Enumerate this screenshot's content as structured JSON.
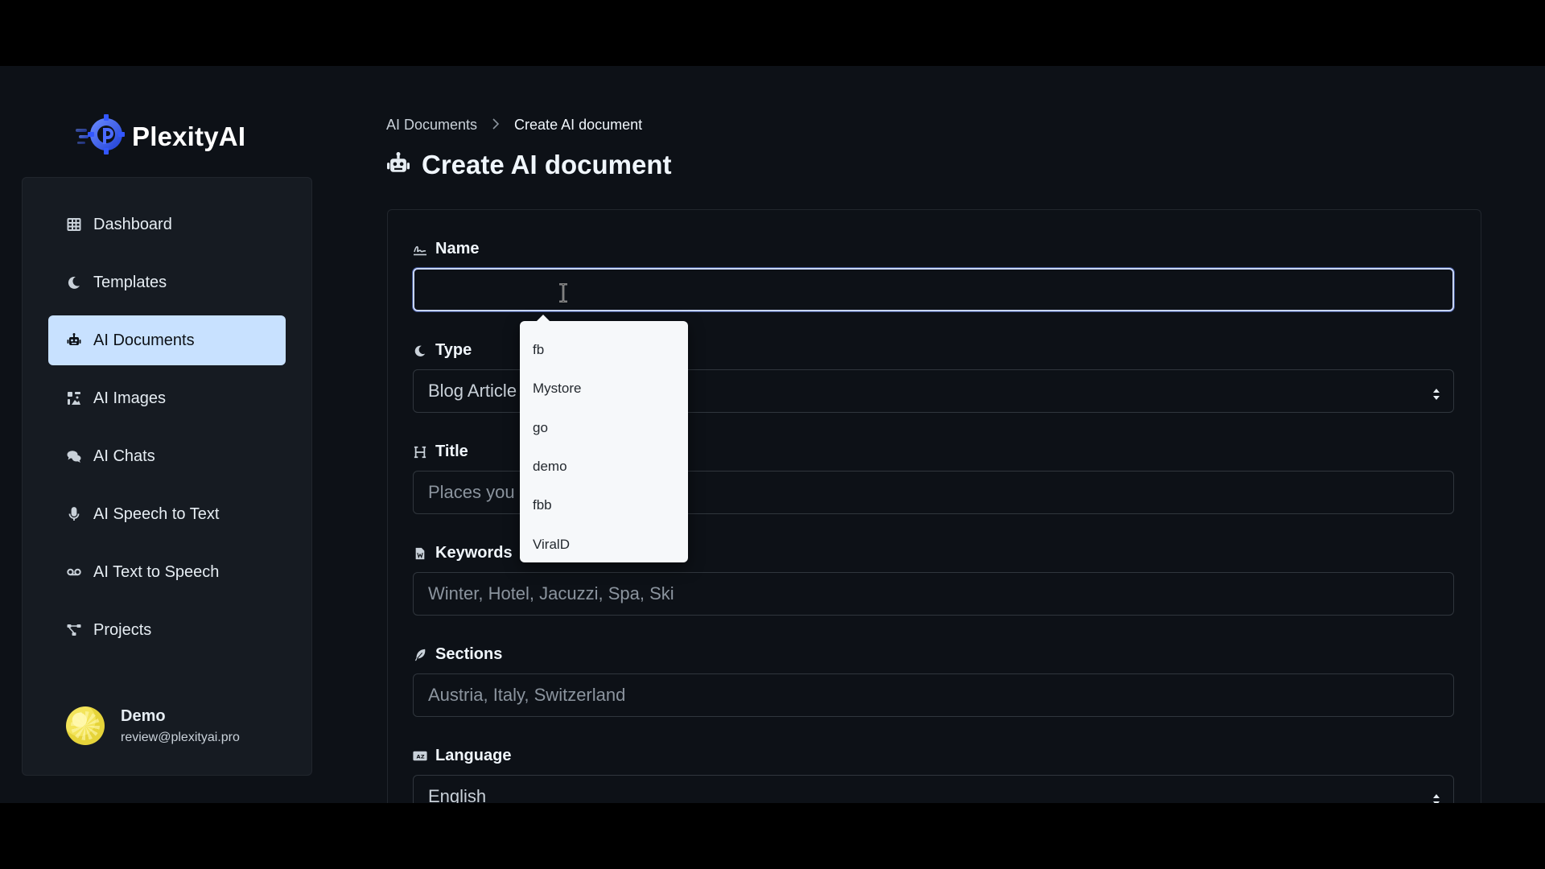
{
  "app": {
    "name": "PlexityAI"
  },
  "sidebar": {
    "items": [
      {
        "label": "Dashboard",
        "icon": "table-icon"
      },
      {
        "label": "Templates",
        "icon": "moon-icon"
      },
      {
        "label": "AI Documents",
        "icon": "robot-icon",
        "active": true
      },
      {
        "label": "AI Images",
        "icon": "images-icon"
      },
      {
        "label": "AI Chats",
        "icon": "chats-icon"
      },
      {
        "label": "AI Speech to Text",
        "icon": "microphone-icon"
      },
      {
        "label": "AI Text to Speech",
        "icon": "voicemail-icon"
      },
      {
        "label": "Projects",
        "icon": "diagram-icon"
      }
    ],
    "user": {
      "name": "Demo",
      "email": "review@plexityai.pro"
    }
  },
  "breadcrumb": {
    "parent": "AI Documents",
    "current": "Create AI document"
  },
  "page": {
    "title": "Create AI document"
  },
  "form": {
    "name": {
      "label": "Name",
      "value": "",
      "icon": "signature-icon"
    },
    "type": {
      "label": "Type",
      "value": "Blog Article",
      "icon": "moon-icon"
    },
    "title": {
      "label": "Title",
      "placeholder": "Places you m",
      "icon": "heading-icon"
    },
    "keywords": {
      "label": "Keywords",
      "placeholder": "Winter, Hotel, Jacuzzi, Spa, Ski",
      "icon": "file-word-icon"
    },
    "sections": {
      "label": "Sections",
      "placeholder": "Austria, Italy, Switzerland",
      "icon": "feather-icon"
    },
    "language": {
      "label": "Language",
      "value": "English",
      "icon": "language-icon"
    }
  },
  "autocomplete": {
    "options": [
      "fb",
      "Mystore",
      "go",
      "demo",
      "fbb",
      "ViralD"
    ]
  },
  "colors": {
    "accent_active": "#c8e1ff",
    "background": "#0d1117",
    "panel": "#161b22"
  }
}
